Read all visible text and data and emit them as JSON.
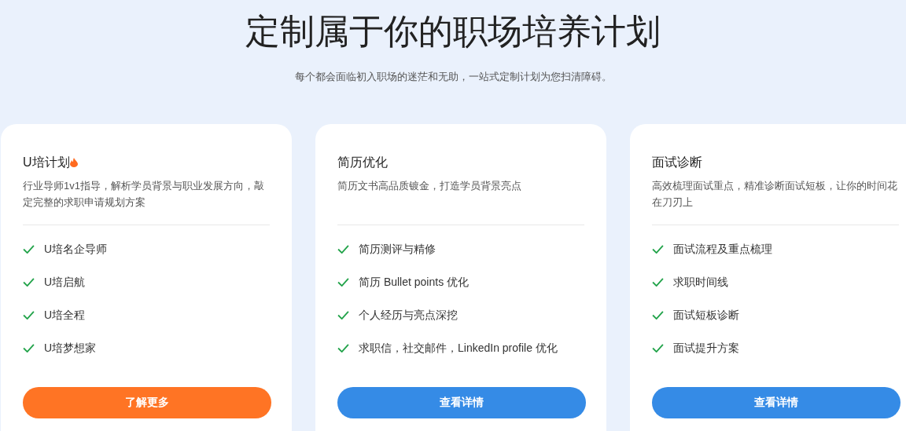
{
  "heading": "定制属于你的职场培养计划",
  "subtitle": "每个都会面临初入职场的迷茫和无助，一站式定制计划为您扫清障碍。",
  "cards": [
    {
      "title": "U培计划",
      "hot": true,
      "description": "行业导师1v1指导，解析学员背景与职业发展方向，敲定完整的求职申请规划方案",
      "features": [
        "U培名企导师",
        "U培启航",
        "U培全程",
        "U培梦想家"
      ],
      "button": {
        "label": "了解更多",
        "color": "#ff7424"
      }
    },
    {
      "title": "简历优化",
      "hot": false,
      "description": "简历文书高品质镀金，打造学员背景亮点",
      "features": [
        "简历测评与精修",
        "简历 Bullet points 优化",
        "个人经历与亮点深挖",
        "求职信，社交邮件，LinkedIn profile 优化"
      ],
      "button": {
        "label": "查看详情",
        "color": "#358be6"
      }
    },
    {
      "title": "面试诊断",
      "hot": false,
      "description": "高效梳理面试重点，精准诊断面试短板，让你的时间花在刀刃上",
      "features": [
        "面试流程及重点梳理",
        "求职时间线",
        "面试短板诊断",
        "面试提升方案"
      ],
      "button": {
        "label": "查看详情",
        "color": "#358be6"
      }
    }
  ]
}
